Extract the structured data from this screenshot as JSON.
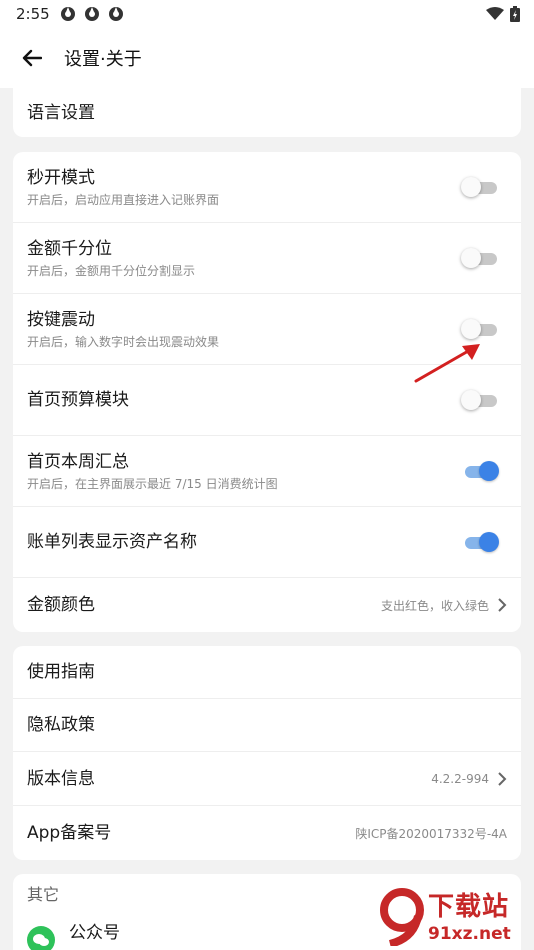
{
  "status_bar": {
    "time": "2:55",
    "icons": [
      "app-notification-icon",
      "app-notification-icon",
      "app-notification-icon"
    ],
    "right_icons": [
      "wifi-icon",
      "battery-icon"
    ]
  },
  "app_bar": {
    "title": "设置·关于"
  },
  "language": {
    "label": "语言设置"
  },
  "settings": {
    "items": [
      {
        "label": "秒开模式",
        "sub": "开启后，启动应用直接进入记账界面",
        "toggle": false
      },
      {
        "label": "金额千分位",
        "sub": "开启后，金额用千分位分割显示",
        "toggle": false
      },
      {
        "label": "按键震动",
        "sub": "开启后，输入数字时会出现震动效果",
        "toggle": false
      },
      {
        "label": "首页预算模块",
        "sub": "",
        "toggle": false
      },
      {
        "label": "首页本周汇总",
        "sub": "开启后，在主界面展示最近 7/15 日消费统计图",
        "toggle": true
      },
      {
        "label": "账单列表显示资产名称",
        "sub": "",
        "toggle": true
      }
    ],
    "amount_color": {
      "label": "金额颜色",
      "value": "支出红色，收入绿色"
    }
  },
  "about": {
    "guide": "使用指南",
    "privacy": "隐私政策",
    "version_label": "版本信息",
    "version_value": "4.2.2-994",
    "icp_label": "App备案号",
    "icp_value": "陕ICP备2020017332号-4A"
  },
  "other": {
    "header": "其它",
    "wechat": "公众号"
  },
  "watermark": {
    "line1": "下载站",
    "line2": "91xz.net"
  },
  "colors": {
    "accent": "#3b82e6",
    "arrow": "#d32020",
    "background": "#f2f2f2"
  }
}
